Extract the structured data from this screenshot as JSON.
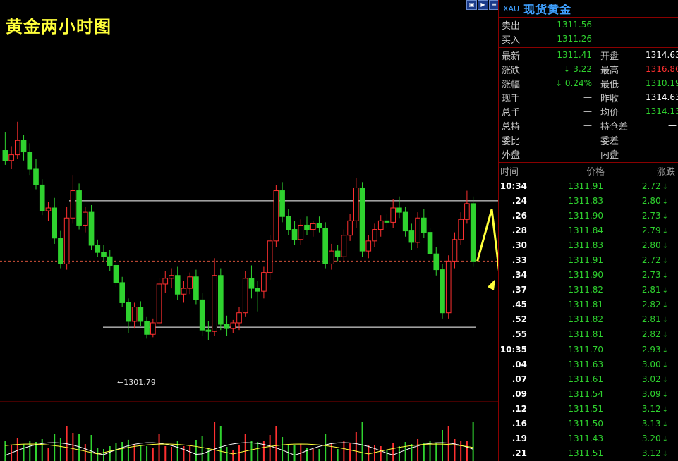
{
  "chart": {
    "title": "黄金两小时图",
    "low_label": "1301.79"
  },
  "chart_data": {
    "type": "candlestick",
    "ylim": [
      1297,
      1324
    ],
    "ohlc": [
      [
        1314.5,
        1315.8,
        1313.5,
        1313.8
      ],
      [
        1313.8,
        1314.8,
        1313.2,
        1314.2
      ],
      [
        1314.2,
        1316.5,
        1313.9,
        1315.2
      ],
      [
        1315.2,
        1315.6,
        1313.8,
        1314.4
      ],
      [
        1314.4,
        1315.0,
        1312.8,
        1313.2
      ],
      [
        1313.2,
        1313.9,
        1311.8,
        1312.1
      ],
      [
        1312.1,
        1312.5,
        1310.0,
        1310.3
      ],
      [
        1310.3,
        1310.9,
        1309.6,
        1310.5
      ],
      [
        1310.5,
        1311.2,
        1308.0,
        1308.4
      ],
      [
        1308.4,
        1308.9,
        1306.3,
        1306.6
      ],
      [
        1306.6,
        1310.6,
        1306.2,
        1309.8
      ],
      [
        1309.8,
        1312.8,
        1309.4,
        1311.7
      ],
      [
        1311.7,
        1312.2,
        1309.0,
        1309.3
      ],
      [
        1309.3,
        1310.6,
        1308.8,
        1310.2
      ],
      [
        1310.2,
        1310.7,
        1307.6,
        1307.9
      ],
      [
        1307.9,
        1308.3,
        1307.1,
        1307.4
      ],
      [
        1307.4,
        1307.9,
        1306.8,
        1307.1
      ],
      [
        1307.1,
        1307.6,
        1306.1,
        1306.5
      ],
      [
        1306.5,
        1306.9,
        1305.0,
        1305.3
      ],
      [
        1305.3,
        1305.7,
        1303.6,
        1303.9
      ],
      [
        1303.9,
        1304.2,
        1301.79,
        1302.6
      ],
      [
        1302.6,
        1303.9,
        1302.1,
        1303.6
      ],
      [
        1303.6,
        1304.0,
        1302.3,
        1302.6
      ],
      [
        1302.6,
        1302.9,
        1301.4,
        1301.7
      ],
      [
        1301.7,
        1302.8,
        1301.5,
        1302.5
      ],
      [
        1302.5,
        1305.6,
        1302.3,
        1305.2
      ],
      [
        1305.2,
        1306.1,
        1304.6,
        1305.6
      ],
      [
        1305.6,
        1306.3,
        1304.9,
        1305.8
      ],
      [
        1305.8,
        1306.4,
        1304.1,
        1304.5
      ],
      [
        1304.5,
        1305.4,
        1303.9,
        1304.9
      ],
      [
        1304.9,
        1306.0,
        1304.5,
        1305.7
      ],
      [
        1305.7,
        1306.2,
        1303.8,
        1304.1
      ],
      [
        1304.1,
        1304.6,
        1301.6,
        1302.0
      ],
      [
        1302.0,
        1302.6,
        1301.3,
        1301.9
      ],
      [
        1301.9,
        1307.0,
        1301.6,
        1305.8
      ],
      [
        1305.8,
        1306.3,
        1302.0,
        1302.4
      ],
      [
        1302.4,
        1303.0,
        1301.6,
        1302.1
      ],
      [
        1302.1,
        1302.7,
        1301.8,
        1302.5
      ],
      [
        1302.5,
        1303.6,
        1302.0,
        1303.2
      ],
      [
        1303.2,
        1306.1,
        1302.9,
        1305.6
      ],
      [
        1305.6,
        1306.5,
        1304.2,
        1304.9
      ],
      [
        1304.9,
        1305.4,
        1303.3,
        1304.7
      ],
      [
        1304.7,
        1306.4,
        1304.2,
        1306.0
      ],
      [
        1306.0,
        1308.6,
        1305.5,
        1308.2
      ],
      [
        1308.2,
        1312.1,
        1307.8,
        1311.7
      ],
      [
        1311.7,
        1312.3,
        1309.5,
        1309.9
      ],
      [
        1309.9,
        1310.4,
        1308.6,
        1309.0
      ],
      [
        1309.0,
        1309.6,
        1307.9,
        1308.3
      ],
      [
        1308.3,
        1309.7,
        1307.9,
        1309.3
      ],
      [
        1309.3,
        1309.9,
        1308.6,
        1309.0
      ],
      [
        1309.0,
        1309.6,
        1308.5,
        1309.4
      ],
      [
        1309.4,
        1309.9,
        1308.8,
        1309.1
      ],
      [
        1309.1,
        1309.5,
        1306.3,
        1306.6
      ],
      [
        1306.6,
        1308.0,
        1306.2,
        1307.5
      ],
      [
        1307.5,
        1307.9,
        1306.8,
        1307.1
      ],
      [
        1307.1,
        1309.0,
        1306.7,
        1308.6
      ],
      [
        1308.6,
        1310.1,
        1308.2,
        1309.6
      ],
      [
        1309.6,
        1312.6,
        1309.1,
        1311.9
      ],
      [
        1311.9,
        1312.3,
        1307.1,
        1307.5
      ],
      [
        1307.5,
        1308.6,
        1307.0,
        1308.2
      ],
      [
        1308.2,
        1309.4,
        1307.8,
        1309.0
      ],
      [
        1309.0,
        1310.0,
        1308.5,
        1309.6
      ],
      [
        1309.6,
        1310.1,
        1309.1,
        1309.5
      ],
      [
        1309.5,
        1311.1,
        1309.1,
        1310.5
      ],
      [
        1310.5,
        1311.3,
        1309.8,
        1310.2
      ],
      [
        1310.2,
        1310.6,
        1308.5,
        1308.9
      ],
      [
        1308.9,
        1309.4,
        1307.6,
        1308.1
      ],
      [
        1308.1,
        1310.2,
        1307.7,
        1309.8
      ],
      [
        1309.8,
        1310.4,
        1308.4,
        1308.8
      ],
      [
        1308.8,
        1309.1,
        1306.9,
        1307.3
      ],
      [
        1307.3,
        1307.8,
        1305.8,
        1306.2
      ],
      [
        1306.2,
        1306.6,
        1302.8,
        1303.2
      ],
      [
        1303.2,
        1307.2,
        1302.8,
        1306.8
      ],
      [
        1306.8,
        1308.8,
        1306.3,
        1308.3
      ],
      [
        1308.3,
        1310.2,
        1307.9,
        1309.7
      ],
      [
        1309.7,
        1311.7,
        1309.4,
        1310.8
      ],
      [
        1310.8,
        1311.3,
        1306.4,
        1306.8
      ]
    ],
    "resistance": 1311.0,
    "support": 1302.2,
    "current_price": 1306.8
  },
  "panel": {
    "symbol": "XAU",
    "name": "现货黄金",
    "quotes": [
      {
        "l": "卖出",
        "v": "1311.56",
        "l2": "",
        "v2": "—"
      },
      {
        "l": "买入",
        "v": "1311.26",
        "l2": "",
        "v2": "—"
      }
    ],
    "stats": [
      {
        "l": "最新",
        "v": "1311.41",
        "l2": "开盘",
        "v2": "1314.63",
        "c2": "#ffffff"
      },
      {
        "l": "涨跌",
        "v": "3.22",
        "arrow": true,
        "l2": "最高",
        "v2": "1316.86",
        "c2": "#ff3030"
      },
      {
        "l": "涨幅",
        "v": "0.24%",
        "arrow": true,
        "l2": "最低",
        "v2": "1310.19",
        "c2": "#2fd22f"
      },
      {
        "l": "现手",
        "v": "—",
        "l2": "昨收",
        "v2": "1314.63",
        "c2": "#ffffff"
      },
      {
        "l": "总手",
        "v": "—",
        "l2": "均价",
        "v2": "1314.13",
        "c2": "#2fd22f"
      },
      {
        "l": "总持",
        "v": "—",
        "l2": "持仓差",
        "v2": "—",
        "c2": "#ffffff"
      },
      {
        "l": "委比",
        "v": "—",
        "l2": "委差",
        "v2": "—",
        "c2": "#ffffff"
      },
      {
        "l": "外盘",
        "v": "—",
        "l2": "内盘",
        "v2": "—",
        "c2": "#ffffff"
      }
    ],
    "trade_header": {
      "time": "时间",
      "price": "价格",
      "change": "涨跌"
    },
    "trades": [
      {
        "t": "10:34",
        "p": "1311.91",
        "c": "2.72"
      },
      {
        "t": ".24",
        "p": "1311.83",
        "c": "2.80"
      },
      {
        "t": ".26",
        "p": "1311.90",
        "c": "2.73"
      },
      {
        "t": ".28",
        "p": "1311.84",
        "c": "2.79"
      },
      {
        "t": ".30",
        "p": "1311.83",
        "c": "2.80"
      },
      {
        "t": ".33",
        "p": "1311.91",
        "c": "2.72"
      },
      {
        "t": ".34",
        "p": "1311.90",
        "c": "2.73"
      },
      {
        "t": ".37",
        "p": "1311.82",
        "c": "2.81"
      },
      {
        "t": ".45",
        "p": "1311.81",
        "c": "2.82"
      },
      {
        "t": ".52",
        "p": "1311.82",
        "c": "2.81"
      },
      {
        "t": ".55",
        "p": "1311.81",
        "c": "2.82"
      },
      {
        "t": "10:35",
        "p": "1311.70",
        "c": "2.93"
      },
      {
        "t": ".04",
        "p": "1311.63",
        "c": "3.00"
      },
      {
        "t": ".07",
        "p": "1311.61",
        "c": "3.02"
      },
      {
        "t": ".09",
        "p": "1311.54",
        "c": "3.09"
      },
      {
        "t": ".12",
        "p": "1311.51",
        "c": "3.12"
      },
      {
        "t": ".16",
        "p": "1311.50",
        "c": "3.13"
      },
      {
        "t": ".19",
        "p": "1311.43",
        "c": "3.20"
      },
      {
        "t": ".21",
        "p": "1311.51",
        "c": "3.12"
      }
    ]
  },
  "colors": {
    "up": "#ff3030",
    "down": "#2fd22f",
    "title": "#ffff3a",
    "accent": "#3fa0ff"
  }
}
